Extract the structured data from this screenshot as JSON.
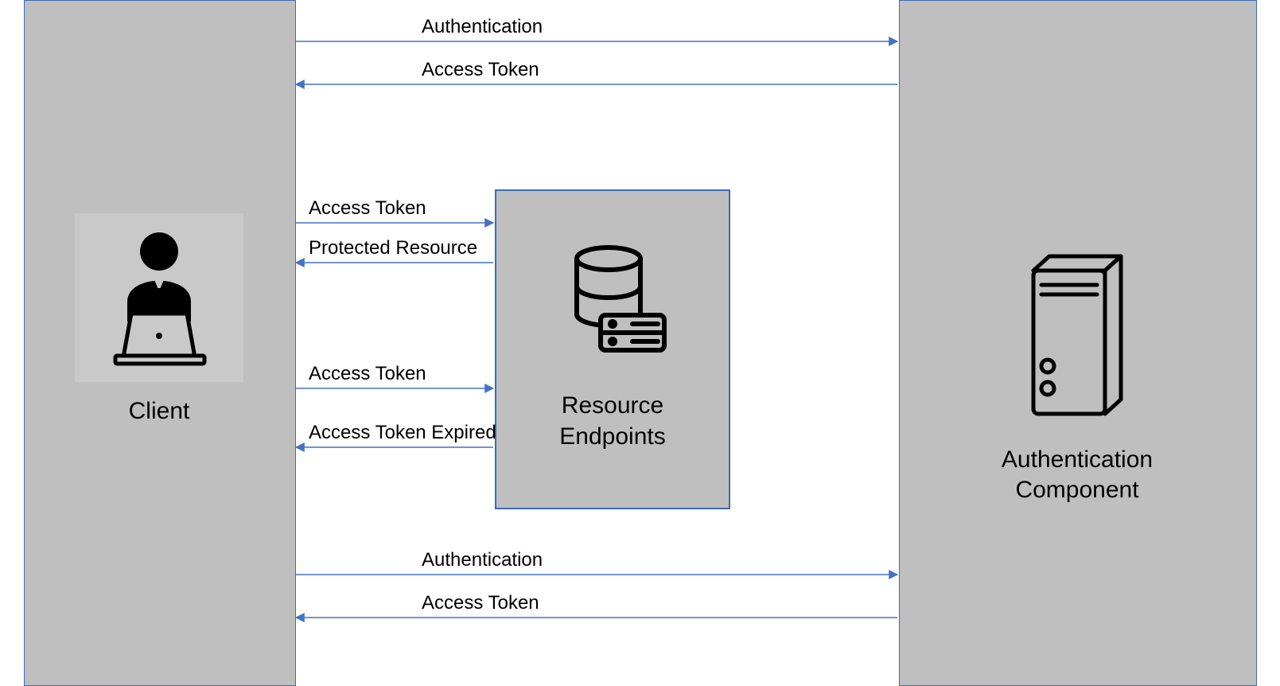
{
  "client": {
    "label": "Client"
  },
  "auth": {
    "label_line1": "Authentication",
    "label_line2": "Component"
  },
  "endpoint": {
    "label_line1": "Resource",
    "label_line2": "Endpoints"
  },
  "arrows": {
    "a1": "Authentication",
    "a2": "Access Token",
    "a3": "Access Token",
    "a4": "Protected Resource",
    "a5": "Access Token",
    "a6": "Access Token Expired",
    "a7": "Authentication",
    "a8": "Access Token"
  }
}
